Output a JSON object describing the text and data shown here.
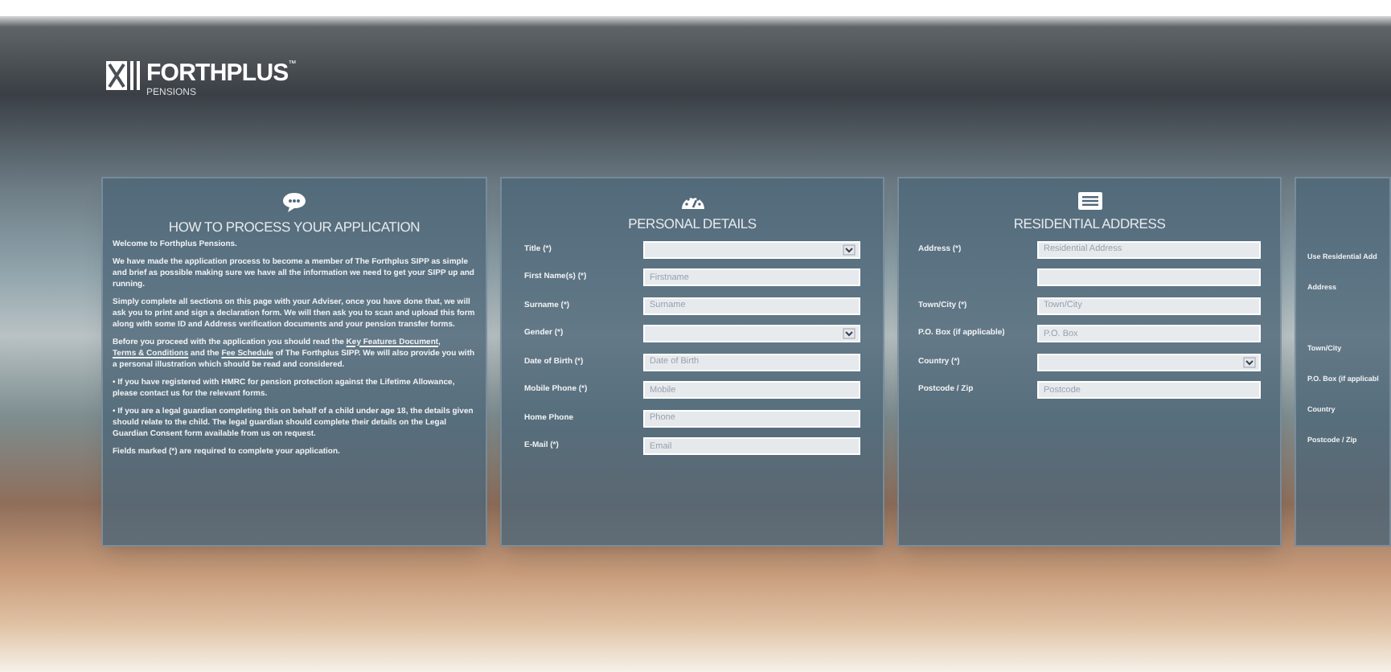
{
  "logo": {
    "name": "FORTHPLUS",
    "trademark": "™",
    "subtitle": "PENSIONS"
  },
  "intro": {
    "title": "HOW TO PROCESS YOUR APPLICATION",
    "paragraphs": [
      [
        {
          "text": "Welcome to Forthplus Pensions.",
          "link": false
        }
      ],
      [
        {
          "text": "We have made the application process to become a member of The Forthplus SIPP as simple and brief as possible making sure we have all the information we need to get your SIPP up and running.",
          "link": false
        }
      ],
      [
        {
          "text": "Simply complete all sections on this page with your Adviser, once you have done that, we will ask you to print and sign a declaration form. We will then ask you to scan and upload this form along with some ID and Address verification documents and your pension transfer forms.",
          "link": false
        }
      ],
      [
        {
          "text": "Before you proceed with the application you should read the ",
          "link": false
        },
        {
          "text": "Key Features Document",
          "link": true
        },
        {
          "text": ", ",
          "link": false
        },
        {
          "text": "Terms & Conditions",
          "link": true
        },
        {
          "text": " and the ",
          "link": false
        },
        {
          "text": "Fee Schedule",
          "link": true
        },
        {
          "text": " of The Forthplus SIPP. We will also provide you with a personal illustration which should be read and considered.",
          "link": false
        }
      ],
      [
        {
          "text": "• If you have registered with HMRC for pension protection against the Lifetime Allowance, please contact us for the relevant forms.",
          "link": false
        }
      ],
      [
        {
          "text": "• If you are a legal guardian completing this on behalf of a child under age 18, the details given should relate to the child. The legal guardian should complete their details on the Legal Guardian Consent form available from us on request.",
          "link": false
        }
      ],
      [
        {
          "text": "Fields marked (*) are required to complete your application.",
          "link": false
        }
      ]
    ]
  },
  "personal": {
    "title": "PERSONAL DETAILS",
    "fields": [
      {
        "label": "Title (*)",
        "kind": "select"
      },
      {
        "label": "First Name(s) (*)",
        "kind": "text",
        "placeholder": "Firstname"
      },
      {
        "label": "Surname (*)",
        "kind": "text",
        "placeholder": "Surname"
      },
      {
        "label": "Gender (*)",
        "kind": "select"
      },
      {
        "label": "Date of Birth (*)",
        "kind": "text",
        "placeholder": "Date of Birth"
      },
      {
        "label": "Mobile Phone (*)",
        "kind": "text",
        "placeholder": "Mobile"
      },
      {
        "label": "Home Phone",
        "kind": "text",
        "placeholder": "Phone"
      },
      {
        "label": "E-Mail (*)",
        "kind": "text",
        "placeholder": "Email"
      }
    ]
  },
  "residential": {
    "title": "RESIDENTIAL ADDRESS",
    "fields": [
      {
        "label": "Address (*)",
        "kind": "text",
        "placeholder": "Residential Address"
      },
      {
        "kind": "text"
      },
      {
        "label": "Town/City (*)",
        "kind": "text",
        "placeholder": "Town/City"
      },
      {
        "label": "P.O. Box (if applicable)",
        "kind": "text",
        "placeholder": "P.O. Box"
      },
      {
        "label": "Country (*)",
        "kind": "select"
      },
      {
        "label": "Postcode / Zip",
        "kind": "text",
        "placeholder": "Postcode"
      }
    ]
  },
  "postal": {
    "rows": [
      {
        "kind": "label",
        "label": "Use Residential Add"
      },
      {
        "kind": "label",
        "label": "Address"
      },
      {
        "kind": "blank"
      },
      {
        "kind": "label",
        "label": "Town/City"
      },
      {
        "kind": "label",
        "label": "P.O. Box (if applicabl"
      },
      {
        "kind": "label",
        "label": "Country"
      },
      {
        "kind": "label",
        "label": "Postcode / Zip"
      }
    ]
  }
}
